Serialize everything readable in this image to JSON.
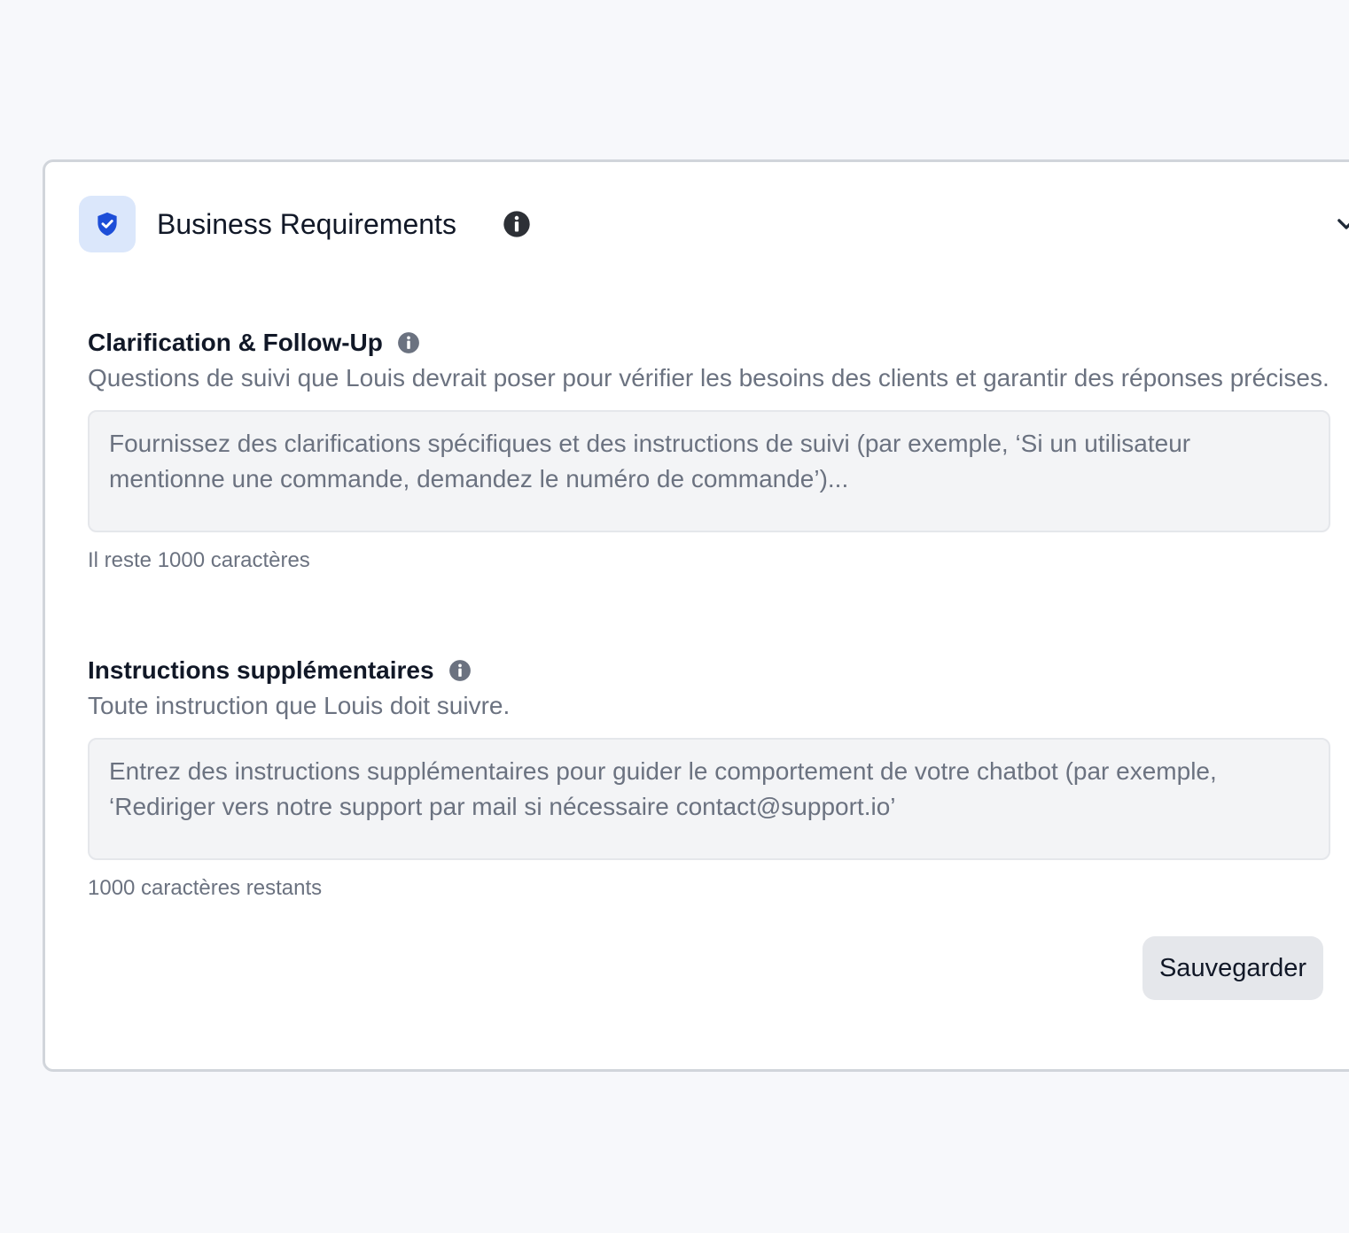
{
  "panel": {
    "title": "Business Requirements",
    "icons": {
      "badge": "shield-check-icon",
      "info": "info-icon",
      "toggle": "chevron-down-icon"
    },
    "colors": {
      "badge_background": "#dbe7fb",
      "badge_icon": "#1d4ed8",
      "button_background": "#e5e7eb"
    }
  },
  "clarification": {
    "title": "Clarification & Follow-Up",
    "description": "Questions de suivi que Louis devrait poser pour vérifier les besoins des clients et garantir des réponses précises.",
    "placeholder": "Fournissez des clarifications spécifiques et des instructions de suivi (par exemple, ‘Si un utilisateur mentionne une commande, demandez le numéro de commande’)...",
    "value": "",
    "counter": "Il reste 1000 caractères"
  },
  "instructions": {
    "title": "Instructions supplémentaires",
    "description": "Toute instruction que Louis doit suivre.",
    "placeholder": "Entrez des instructions supplémentaires pour guider le comportement de votre chatbot (par exemple, ‘Rediriger vers notre support par mail si nécessaire contact@support.io’",
    "value": "",
    "counter": "1000 caractères restants"
  },
  "actions": {
    "save_label": "Sauvegarder"
  }
}
